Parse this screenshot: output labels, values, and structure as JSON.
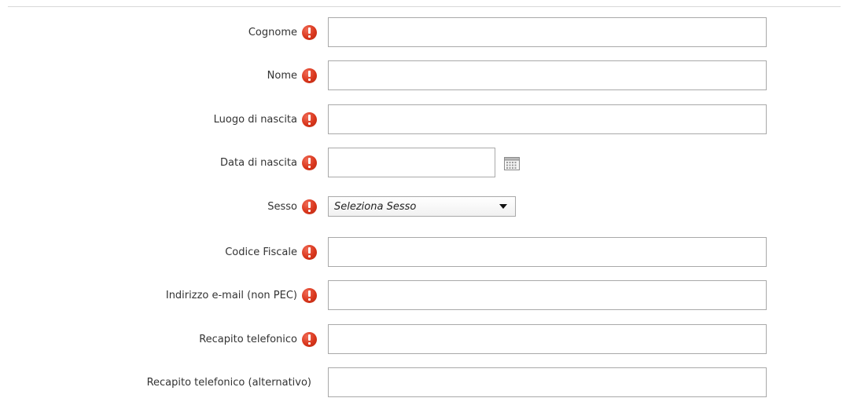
{
  "form": {
    "fields": [
      {
        "label": "Cognome",
        "required": true,
        "type": "text",
        "value": ""
      },
      {
        "label": "Nome",
        "required": true,
        "type": "text",
        "value": ""
      },
      {
        "label": "Luogo di nascita",
        "required": true,
        "type": "text",
        "value": ""
      },
      {
        "label": "Data di nascita",
        "required": true,
        "type": "date",
        "value": ""
      },
      {
        "label": "Sesso",
        "required": true,
        "type": "select",
        "selected": "Seleziona Sesso"
      },
      {
        "label": "Codice Fiscale",
        "required": true,
        "type": "text",
        "value": ""
      },
      {
        "label": "Indirizzo e-mail (non PEC)",
        "required": true,
        "type": "text",
        "value": ""
      },
      {
        "label": "Recapito telefonico",
        "required": true,
        "type": "text",
        "value": ""
      },
      {
        "label": "Recapito telefonico (alternativo)",
        "required": false,
        "type": "text",
        "value": ""
      }
    ]
  },
  "icons": {
    "required": "exclamation-circle-icon",
    "calendar": "calendar-icon",
    "dropdown": "chevron-down-icon"
  },
  "colors": {
    "required_icon": "#d9361c",
    "input_border": "#a9a9a9",
    "label_text": "#333333"
  }
}
